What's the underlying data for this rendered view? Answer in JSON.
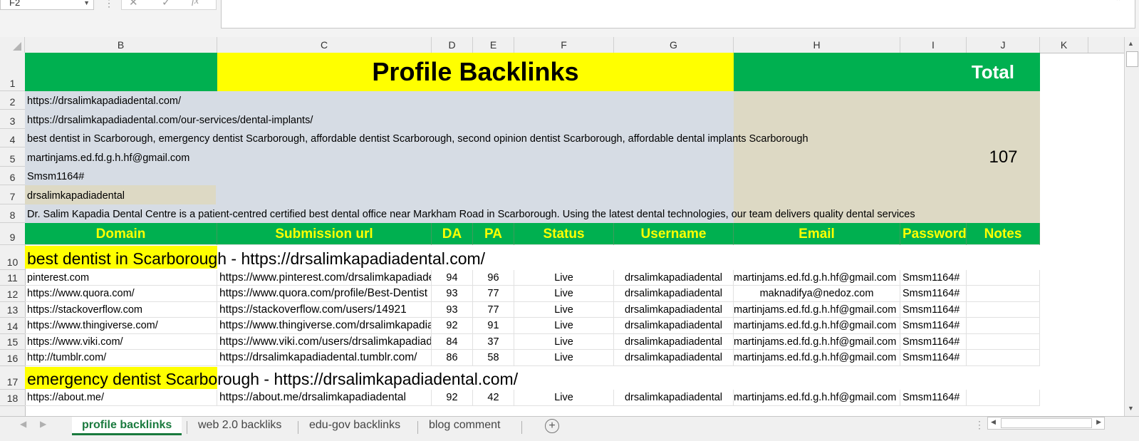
{
  "formula_bar": {
    "name_box": "F2",
    "fx_label": "fx"
  },
  "columns": [
    "B",
    "C",
    "D",
    "E",
    "F",
    "G",
    "H",
    "I",
    "J",
    "K"
  ],
  "rows": [
    "1",
    "2",
    "3",
    "4",
    "5",
    "6",
    "7",
    "8",
    "9",
    "10",
    "11",
    "12",
    "13",
    "14",
    "15",
    "16",
    "17",
    "18"
  ],
  "title": "Profile Backlinks",
  "total_label": "Total",
  "total_value": "107",
  "info": {
    "r2": "https://drsalimkapadiadental.com/",
    "r3": "https://drsalimkapadiadental.com/our-services/dental-implants/",
    "r4": "best dentist in Scarborough, emergency dentist Scarborough, affordable dentist Scarborough, second opinion dentist Scarborough, affordable dental implants Scarborough",
    "r5": "martinjams.ed.fd.g.h.hf@gmail.com",
    "r6": "Smsm1164#",
    "r7": "drsalimkapadiadental",
    "r8": "Dr. Salim Kapadia Dental Centre is a patient-centred certified best dental office near Markham Road in Scarborough. Using the latest dental technologies, our team delivers quality dental services"
  },
  "headers": {
    "domain": "Domain",
    "url": "Submission url",
    "da": "DA",
    "pa": "PA",
    "status": "Status",
    "username": "Username",
    "email": "Email",
    "password": "Password",
    "notes": "Notes"
  },
  "section1": {
    "keyword": "best dentist in Scarborough",
    "rest": " - https://drsalimkapadiadental.com/"
  },
  "section2": {
    "keyword": "emergency dentist Scarborough",
    "rest": " - https://drsalimkapadiadental.com/"
  },
  "data_rows": [
    {
      "domain": "pinterest.com",
      "url": "https://www.pinterest.com/drsalimkapadiadental/",
      "da": "94",
      "pa": "96",
      "status": "Live",
      "username": "drsalimkapadiadental",
      "email": "martinjams.ed.fd.g.h.hf@gmail.com",
      "password": "Smsm1164#"
    },
    {
      "domain": "https://www.quora.com/",
      "url": "https://www.quora.com/profile/Best-Dentist",
      "da": "93",
      "pa": "77",
      "status": "Live",
      "username": "drsalimkapadiadental",
      "email": "maknadifya@nedoz.com",
      "password": "Smsm1164#"
    },
    {
      "domain": "https://stackoverflow.com",
      "url": "https://stackoverflow.com/users/14921",
      "da": "93",
      "pa": "77",
      "status": "Live",
      "username": "drsalimkapadiadental",
      "email": "martinjams.ed.fd.g.h.hf@gmail.com",
      "password": "Smsm1164#"
    },
    {
      "domain": "https://www.thingiverse.com/",
      "url": "https://www.thingiverse.com/drsalimkapadiadental",
      "da": "92",
      "pa": "91",
      "status": "Live",
      "username": "drsalimkapadiadental",
      "email": "martinjams.ed.fd.g.h.hf@gmail.com",
      "password": "Smsm1164#"
    },
    {
      "domain": "https://www.viki.com/",
      "url": "https://www.viki.com/users/drsalimkapadiadental",
      "da": "84",
      "pa": "37",
      "status": "Live",
      "username": "drsalimkapadiadental",
      "email": "martinjams.ed.fd.g.h.hf@gmail.com",
      "password": "Smsm1164#"
    },
    {
      "domain": "http://tumblr.com/",
      "url": "https://drsalimkapadiadental.tumblr.com/",
      "da": "86",
      "pa": "58",
      "status": "Live",
      "username": "drsalimkapadiadental",
      "email": "martinjams.ed.fd.g.h.hf@gmail.com",
      "password": "Smsm1164#"
    }
  ],
  "row18": {
    "domain": "https://about.me/",
    "url": "https://about.me/drsalimkapadiadental",
    "da": "92",
    "pa": "42",
    "status": "Live",
    "username": "drsalimkapadiadental",
    "email": "martinjams.ed.fd.g.h.hf@gmail.com",
    "password": "Smsm1164#"
  },
  "tabs": [
    "profile backlinks",
    "web 2.0 backliks",
    "edu-gov backlinks",
    "blog comment"
  ],
  "colors": {
    "green": "#00b050",
    "yellow": "#ffff00",
    "blue_gray": "#d6dce4",
    "tan": "#ddd9c4"
  }
}
